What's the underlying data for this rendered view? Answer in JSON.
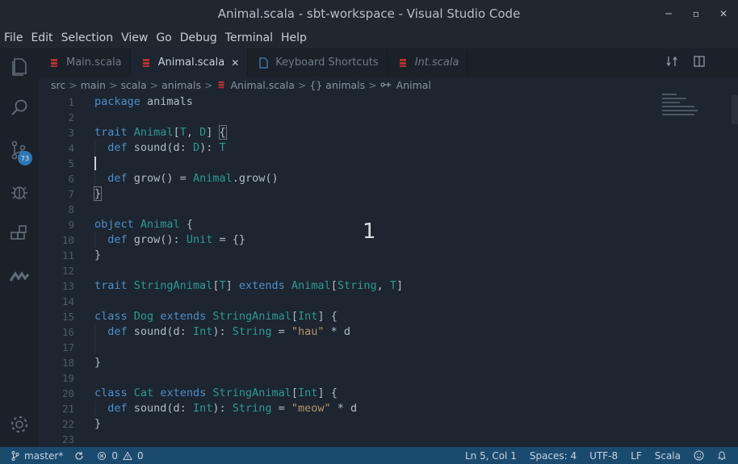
{
  "window": {
    "title": "Animal.scala - sbt-workspace - Visual Studio Code",
    "controls": [
      "─",
      "▫",
      "✕"
    ]
  },
  "menu": [
    "File",
    "Edit",
    "Selection",
    "View",
    "Go",
    "Debug",
    "Terminal",
    "Help"
  ],
  "activity": {
    "icons": [
      "explorer-icon",
      "search-icon",
      "source-control-icon",
      "debug-icon",
      "extensions-icon",
      "metals-icon",
      "gear-icon"
    ],
    "scm_badge": "73"
  },
  "tabs": [
    {
      "label": "Main.scala",
      "active": false,
      "italic": false,
      "icon": "scala-file-icon"
    },
    {
      "label": "Animal.scala",
      "active": true,
      "italic": false,
      "icon": "scala-file-icon",
      "close": "✕"
    },
    {
      "label": "Keyboard Shortcuts",
      "active": false,
      "italic": false,
      "icon": "document-icon"
    },
    {
      "label": "Int.scala",
      "active": false,
      "italic": true,
      "icon": "scala-file-icon"
    }
  ],
  "breadcrumb": [
    "src",
    "main",
    "scala",
    "animals",
    "Animal.scala",
    "{} animals",
    "Animal"
  ],
  "editor": {
    "line_numbers": [
      "1",
      "2",
      "3",
      "4",
      "5",
      "6",
      "7",
      "8",
      "9",
      "10",
      "11",
      "12",
      "13",
      "14",
      "15",
      "16",
      "17",
      "18",
      "19",
      "20",
      "21",
      "22",
      "23"
    ],
    "overlay_number": "1"
  },
  "colors": {
    "keyword": "#4f8ec8",
    "type": "#2e9a91",
    "string": "#b4946a",
    "statusbar": "#1b4a6f"
  },
  "status": {
    "branch": "master*",
    "errors": "0",
    "warnings": "0",
    "position": "Ln 5, Col 1",
    "spaces": "Spaces: 4",
    "encoding": "UTF-8",
    "eol": "LF",
    "language": "Scala"
  }
}
